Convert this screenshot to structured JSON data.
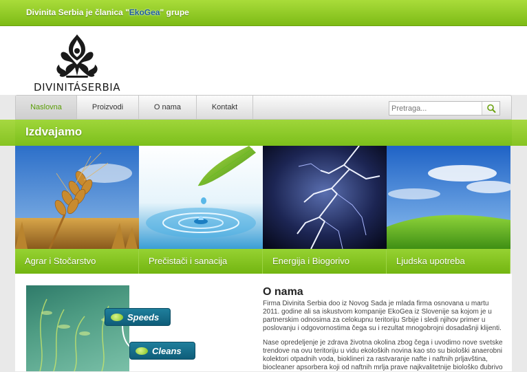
{
  "topbar": {
    "tagline_pre": "Divinita Serbia je članica \"",
    "tagline_brand": "EkoGea",
    "tagline_post": "\" grupe"
  },
  "logo": {
    "wordmark": "DIVINITÁSERBIA"
  },
  "nav": {
    "items": [
      {
        "label": "Naslovna",
        "active": true
      },
      {
        "label": "Proizvodi"
      },
      {
        "label": "O nama"
      },
      {
        "label": "Kontakt"
      }
    ],
    "search_placeholder": "Pretraga..."
  },
  "featured": {
    "title": "Izdvajamo",
    "tiles": [
      {
        "caption": "Agrar i Stočarstvo",
        "icon": "wheat-image"
      },
      {
        "caption": "Prečistači i sanacija",
        "icon": "water-drop-image"
      },
      {
        "caption": "Energija i Biogorivo",
        "icon": "lightning-image"
      },
      {
        "caption": "Ljudska upotreba",
        "icon": "green-field-image"
      }
    ]
  },
  "promo": {
    "label1": "Speeds",
    "label2": "Cleans"
  },
  "about": {
    "title": "O nama",
    "p1": "Firma Divinita Serbia doo iz Novog Sada je mlada firma osnovana u martu 2011. godine ali sa iskustvom kompanije EkoGea iz Slovenije sa kojom je u partnerskim odnosima za celokupnu teritoriju Srbije i sledi njihov primer u poslovanju i odgovornostima čega su i rezultat mnogobrojni dosadašnji klijenti.",
    "p2": "Nase opredeljenje je zdrava životna okolina zbog čega i uvodimo nove svetske trendove na ovu teritoriju u vidu ekoloških novina kao sto su biološki anaerobni kolektori otpadnih voda, bioklineri za rastvaranje nafte i naftnih prljavština, biocleaner apsorbera koji od naftnih mrlja prave najkvalitetnije biološko đubrivo"
  },
  "colors": {
    "accent": "#7dbb16",
    "active_nav_text": "#5a9e06",
    "pill": "#1f7f9c"
  }
}
